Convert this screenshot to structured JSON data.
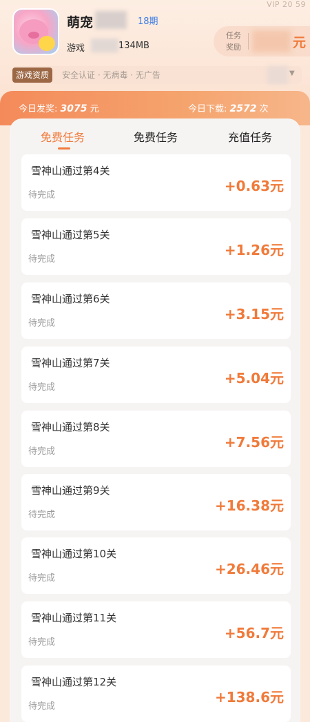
{
  "header": {
    "vip_text": "VIP 20  59",
    "app_name": "萌宠",
    "period": "18期",
    "app_type": "游戏",
    "app_size": "134MB",
    "reward_label": "任务奖励",
    "reward_unit": "元"
  },
  "qualification": {
    "badge": "游戏资质",
    "text": "安全认证 · 无病毒 · 无广告",
    "caret": "▼"
  },
  "stats": {
    "today_payout_label": "今日发奖:",
    "today_payout_value": "3075",
    "today_payout_unit": "元",
    "today_download_label": "今日下载:",
    "today_download_value": "2572",
    "today_download_unit": "次"
  },
  "tabs": [
    {
      "label": "免费任务",
      "active": true
    },
    {
      "label": "免费任务",
      "active": false
    },
    {
      "label": "充值任务",
      "active": false
    }
  ],
  "tasks": [
    {
      "title": "雪神山通过第4关",
      "status": "待完成",
      "reward": "+0.63元"
    },
    {
      "title": "雪神山通过第5关",
      "status": "待完成",
      "reward": "+1.26元"
    },
    {
      "title": "雪神山通过第6关",
      "status": "待完成",
      "reward": "+3.15元"
    },
    {
      "title": "雪神山通过第7关",
      "status": "待完成",
      "reward": "+5.04元"
    },
    {
      "title": "雪神山通过第8关",
      "status": "待完成",
      "reward": "+7.56元"
    },
    {
      "title": "雪神山通过第9关",
      "status": "待完成",
      "reward": "+16.38元"
    },
    {
      "title": "雪神山通过第10关",
      "status": "待完成",
      "reward": "+26.46元"
    },
    {
      "title": "雪神山通过第11关",
      "status": "待完成",
      "reward": "+56.7元"
    },
    {
      "title": "雪神山通过第12关",
      "status": "待完成",
      "reward": "+138.6元"
    }
  ],
  "colors": {
    "accent": "#f07a3a",
    "period_blue": "#3d7de6",
    "badge_brown": "#9c6744"
  }
}
